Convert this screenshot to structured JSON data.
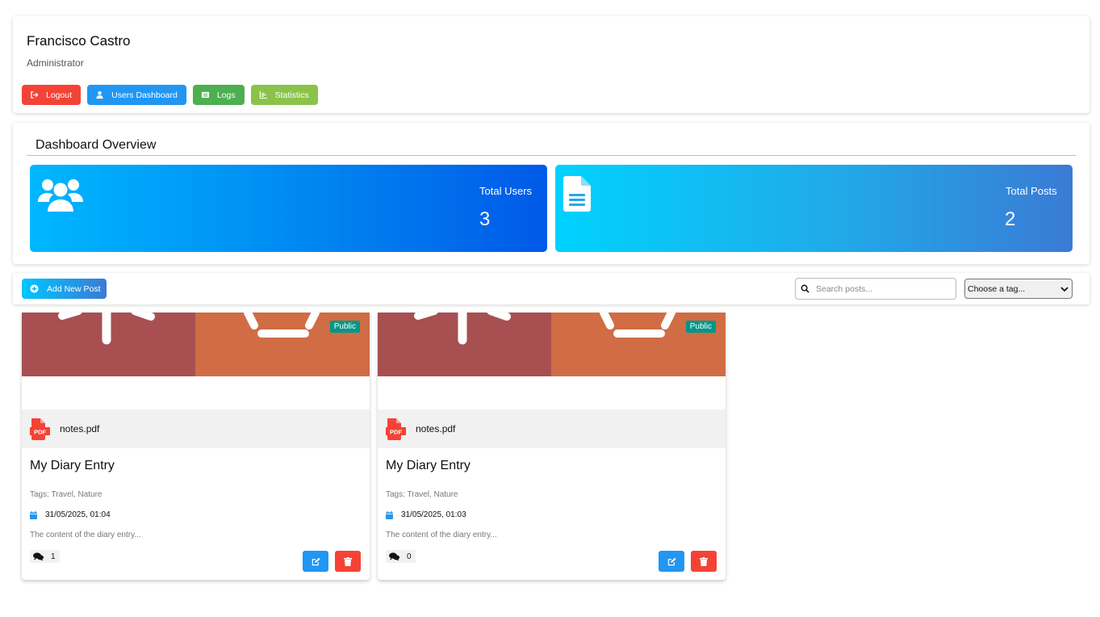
{
  "header": {
    "user_name": "Francisco Castro",
    "user_role": "Administrator",
    "buttons": [
      {
        "label": "Logout",
        "icon": "logout-icon",
        "color": "#f44336"
      },
      {
        "label": "Users Dashboard",
        "icon": "user-icon",
        "color": "#2196f3"
      },
      {
        "label": "Logs",
        "icon": "list-icon",
        "color": "#4caf50"
      },
      {
        "label": "Statistics",
        "icon": "chart-icon",
        "color": "#8bc34a"
      }
    ]
  },
  "overview": {
    "title": "Dashboard Overview",
    "stats": [
      {
        "label": "Total Users",
        "value": "3",
        "icon": "users-icon"
      },
      {
        "label": "Total Posts",
        "value": "2",
        "icon": "file-icon"
      }
    ]
  },
  "toolbar": {
    "add_label": "Add New Post",
    "search_placeholder": "Search posts...",
    "tag_select_value": "Choose a tag..."
  },
  "posts": [
    {
      "badge": "Public",
      "attachment": "notes.pdf",
      "title": "My Diary Entry",
      "tags": "Tags: Travel, Nature",
      "date": "31/05/2025, 01:04",
      "content": "The content of the diary entry...",
      "comments": "1"
    },
    {
      "badge": "Public",
      "attachment": "notes.pdf",
      "title": "My Diary Entry",
      "tags": "Tags: Travel, Nature",
      "date": "31/05/2025, 01:03",
      "content": "The content of the diary entry...",
      "comments": "0"
    }
  ],
  "colors": {
    "danger": "#f44336",
    "primary": "#2196f3",
    "success": "#4caf50",
    "lime": "#8bc34a",
    "badge": "#009688"
  }
}
